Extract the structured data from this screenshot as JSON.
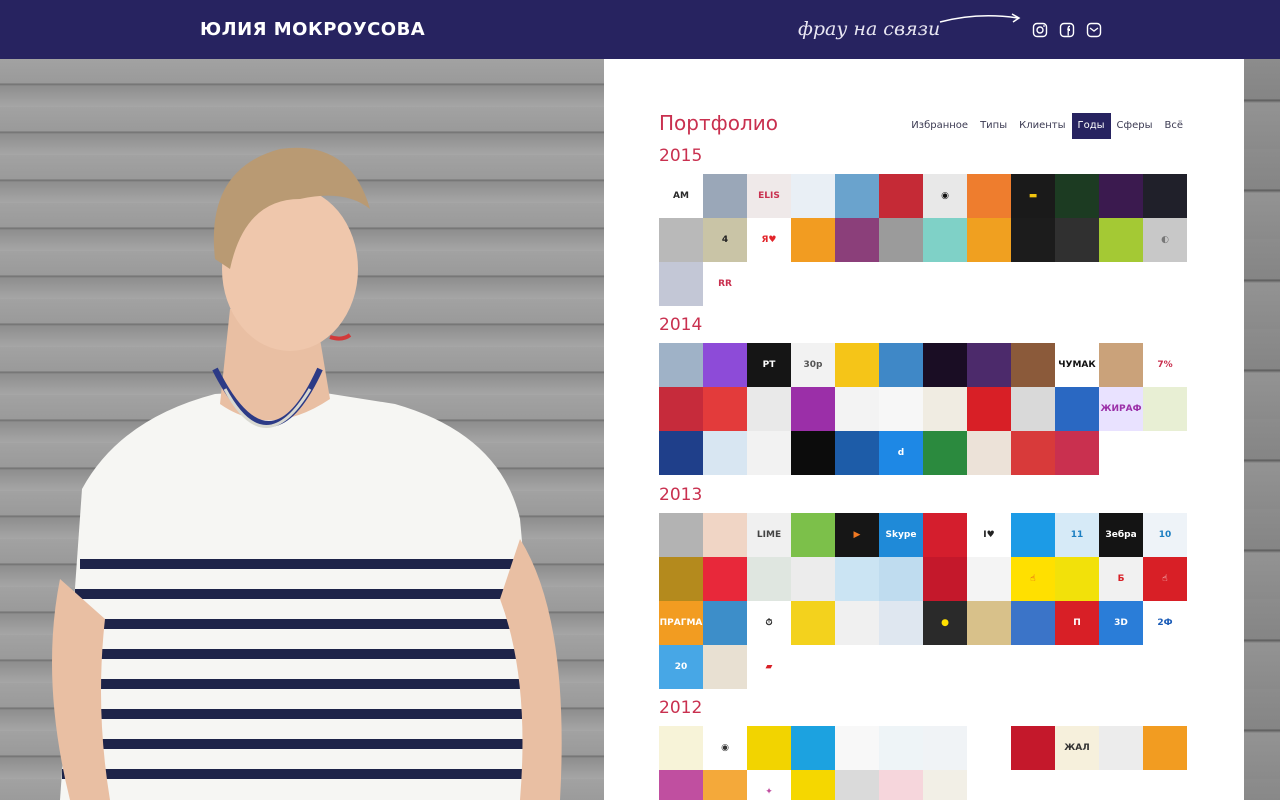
{
  "header": {
    "brand": "ЮЛИЯ МОКРОУСОВА",
    "contact_label": "фрау на связи",
    "social": [
      "instagram-icon",
      "facebook-icon",
      "mail-icon"
    ]
  },
  "portfolio": {
    "title": "Портфолио",
    "filters": [
      {
        "label": "Избранное"
      },
      {
        "label": "Типы"
      },
      {
        "label": "Клиенты"
      },
      {
        "label": "Годы",
        "active": true
      },
      {
        "label": "Сферы"
      },
      {
        "label": "Всё"
      }
    ],
    "years": [
      {
        "year": "2015",
        "tiles": [
          {
            "bg": "#ffffff",
            "fg": "#2a2a2a",
            "text": "AM"
          },
          {
            "bg": "#9aa7b8"
          },
          {
            "bg": "#efe9e9",
            "fg": "#c9304f",
            "text": "ELIS"
          },
          {
            "bg": "#e9eff5",
            "fg": "#2d6fb7"
          },
          {
            "bg": "#6aa3cd"
          },
          {
            "bg": "#c52a36"
          },
          {
            "bg": "#e8e8e8",
            "fg": "#111",
            "text": "◉"
          },
          {
            "bg": "#ee7d2e"
          },
          {
            "bg": "#1a1a1a",
            "fg": "#f1c40f",
            "text": "▬"
          },
          {
            "bg": "#1c3b22"
          },
          {
            "bg": "#3b1a4f"
          },
          {
            "bg": "#20202a",
            "fg": "#ffd54a"
          },
          {
            "bg": "#b9b9b9"
          },
          {
            "bg": "#c9c4a6",
            "fg": "#222",
            "text": "4"
          },
          {
            "bg": "#ffffff",
            "fg": "#e2242a",
            "text": "Я♥"
          },
          {
            "bg": "#f29c21"
          },
          {
            "bg": "#8b3f7a"
          },
          {
            "bg": "#9b9b9b"
          },
          {
            "bg": "#7fd1c7"
          },
          {
            "bg": "#f0a020"
          },
          {
            "bg": "#1c1c1c"
          },
          {
            "bg": "#303030"
          },
          {
            "bg": "#a4c934"
          },
          {
            "bg": "#c8c8c8",
            "fg": "#777",
            "text": "◐"
          },
          {
            "bg": "#c3c7d6"
          },
          {
            "bg": "#ffffff",
            "fg": "#c9304f",
            "text": "RR"
          }
        ]
      },
      {
        "year": "2014",
        "tiles": [
          {
            "bg": "#9fb2c7"
          },
          {
            "bg": "#8d4bd8"
          },
          {
            "bg": "#151515",
            "fg": "#ffffff",
            "text": "РТ"
          },
          {
            "bg": "#f2f2f2",
            "fg": "#555",
            "text": "30р"
          },
          {
            "bg": "#f5c518"
          },
          {
            "bg": "#3f88c7"
          },
          {
            "bg": "#1a0d24"
          },
          {
            "bg": "#4c2a6b"
          },
          {
            "bg": "#8b5a3a"
          },
          {
            "bg": "#ffffff",
            "fg": "#111",
            "text": "ЧУМАК"
          },
          {
            "bg": "#caa27a"
          },
          {
            "bg": "#ffffff",
            "fg": "#c9304f",
            "text": "7%"
          },
          {
            "bg": "#c62b3b"
          },
          {
            "bg": "#e33b3b"
          },
          {
            "bg": "#e9e9e9"
          },
          {
            "bg": "#9b2fa8"
          },
          {
            "bg": "#f3f3f3"
          },
          {
            "bg": "#f7f7f7"
          },
          {
            "bg": "#f0ece2"
          },
          {
            "bg": "#d81f26"
          },
          {
            "bg": "#d9d9d9"
          },
          {
            "bg": "#2a68c2"
          },
          {
            "bg": "#e9e2ff",
            "fg": "#9b2fa8",
            "text": "ЖИРАФ"
          },
          {
            "bg": "#e8efd4"
          },
          {
            "bg": "#1f3f8a"
          },
          {
            "bg": "#d8e6f2"
          },
          {
            "bg": "#f2f2f2"
          },
          {
            "bg": "#0c0c0c"
          },
          {
            "bg": "#1d5ca8"
          },
          {
            "bg": "#1e88e5",
            "fg": "#ffffff",
            "text": "d"
          },
          {
            "bg": "#2b8a3e"
          },
          {
            "bg": "#ece2d8"
          },
          {
            "bg": "#d83a3a"
          },
          {
            "bg": "#c9304f"
          }
        ]
      },
      {
        "year": "2013",
        "tiles": [
          {
            "bg": "#b3b3b3"
          },
          {
            "bg": "#f0d5c5"
          },
          {
            "bg": "#f0f0f0",
            "fg": "#444",
            "text": "LIME"
          },
          {
            "bg": "#7cc04a"
          },
          {
            "bg": "#161616",
            "fg": "#f07822",
            "text": "▶"
          },
          {
            "bg": "#1f8ad8",
            "fg": "#ffffff",
            "text": "Skype"
          },
          {
            "bg": "#d41e2d"
          },
          {
            "bg": "#ffffff",
            "fg": "#222",
            "text": "I♥"
          },
          {
            "bg": "#1c9be6"
          },
          {
            "bg": "#d6eaf7",
            "fg": "#1c7fc2",
            "text": "11"
          },
          {
            "bg": "#141414",
            "fg": "#ffffff",
            "text": "Зебра"
          },
          {
            "bg": "#eef3f8",
            "fg": "#1c7fc2",
            "text": "10"
          },
          {
            "bg": "#b48a1d"
          },
          {
            "bg": "#e8283a"
          },
          {
            "bg": "#dfe6e0"
          },
          {
            "bg": "#ececec"
          },
          {
            "bg": "#cbe4f3"
          },
          {
            "bg": "#bfdcef"
          },
          {
            "bg": "#c4182b"
          },
          {
            "bg": "#f4f4f4"
          },
          {
            "bg": "#ffe000",
            "fg": "#d81f26",
            "text": "☝"
          },
          {
            "bg": "#f2e10a"
          },
          {
            "bg": "#f1f1f1",
            "fg": "#d81f26",
            "text": "Б"
          },
          {
            "bg": "#d81f26",
            "fg": "#ffffff",
            "text": "☝"
          },
          {
            "bg": "#f29c21",
            "fg": "#ffffff",
            "text": "ПРАГМА"
          },
          {
            "bg": "#3d8ec9"
          },
          {
            "bg": "#ffffff",
            "fg": "#222",
            "text": "⏱"
          },
          {
            "bg": "#f3d21d"
          },
          {
            "bg": "#f0f0f0"
          },
          {
            "bg": "#dfe7f0"
          },
          {
            "bg": "#2a2a2a",
            "fg": "#ffe000",
            "text": "●"
          },
          {
            "bg": "#d8c18a"
          },
          {
            "bg": "#3b74c8"
          },
          {
            "bg": "#d81f26",
            "fg": "#ffffff",
            "text": "П"
          },
          {
            "bg": "#2a7dd8",
            "fg": "#ffffff",
            "text": "3D"
          },
          {
            "bg": "#ffffff",
            "fg": "#1c5db8",
            "text": "2Ф"
          },
          {
            "bg": "#47a7e6",
            "fg": "#ffffff",
            "text": "20"
          },
          {
            "bg": "#e8e0d2"
          },
          {
            "bg": "#ffffff",
            "fg": "#d81f26",
            "text": "▰"
          }
        ]
      },
      {
        "year": "2012",
        "tiles": [
          {
            "bg": "#f7f3d8"
          },
          {
            "bg": "#ffffff",
            "fg": "#333",
            "text": "◉"
          },
          {
            "bg": "#f2d400"
          },
          {
            "bg": "#1ca2e0"
          },
          {
            "bg": "#f8f8f8"
          },
          {
            "bg": "#eef4f7"
          },
          {
            "bg": "#f0f3f6"
          },
          {
            "bg": "#ffffff"
          },
          {
            "bg": "#c4182b"
          },
          {
            "bg": "#f6f0dc",
            "fg": "#333",
            "text": "ЖАЛ"
          },
          {
            "bg": "#ececec"
          },
          {
            "bg": "#f29c21"
          },
          {
            "bg": "#c04fa0"
          },
          {
            "bg": "#f4a93a"
          },
          {
            "bg": "#ffffff",
            "fg": "#c04fa0",
            "text": "✦"
          },
          {
            "bg": "#f5d700"
          },
          {
            "bg": "#dadada"
          },
          {
            "bg": "#f6d6dc"
          },
          {
            "bg": "#f2efe6"
          }
        ]
      }
    ]
  },
  "colors": {
    "header_bg": "#272360",
    "accent": "#c9304f"
  }
}
